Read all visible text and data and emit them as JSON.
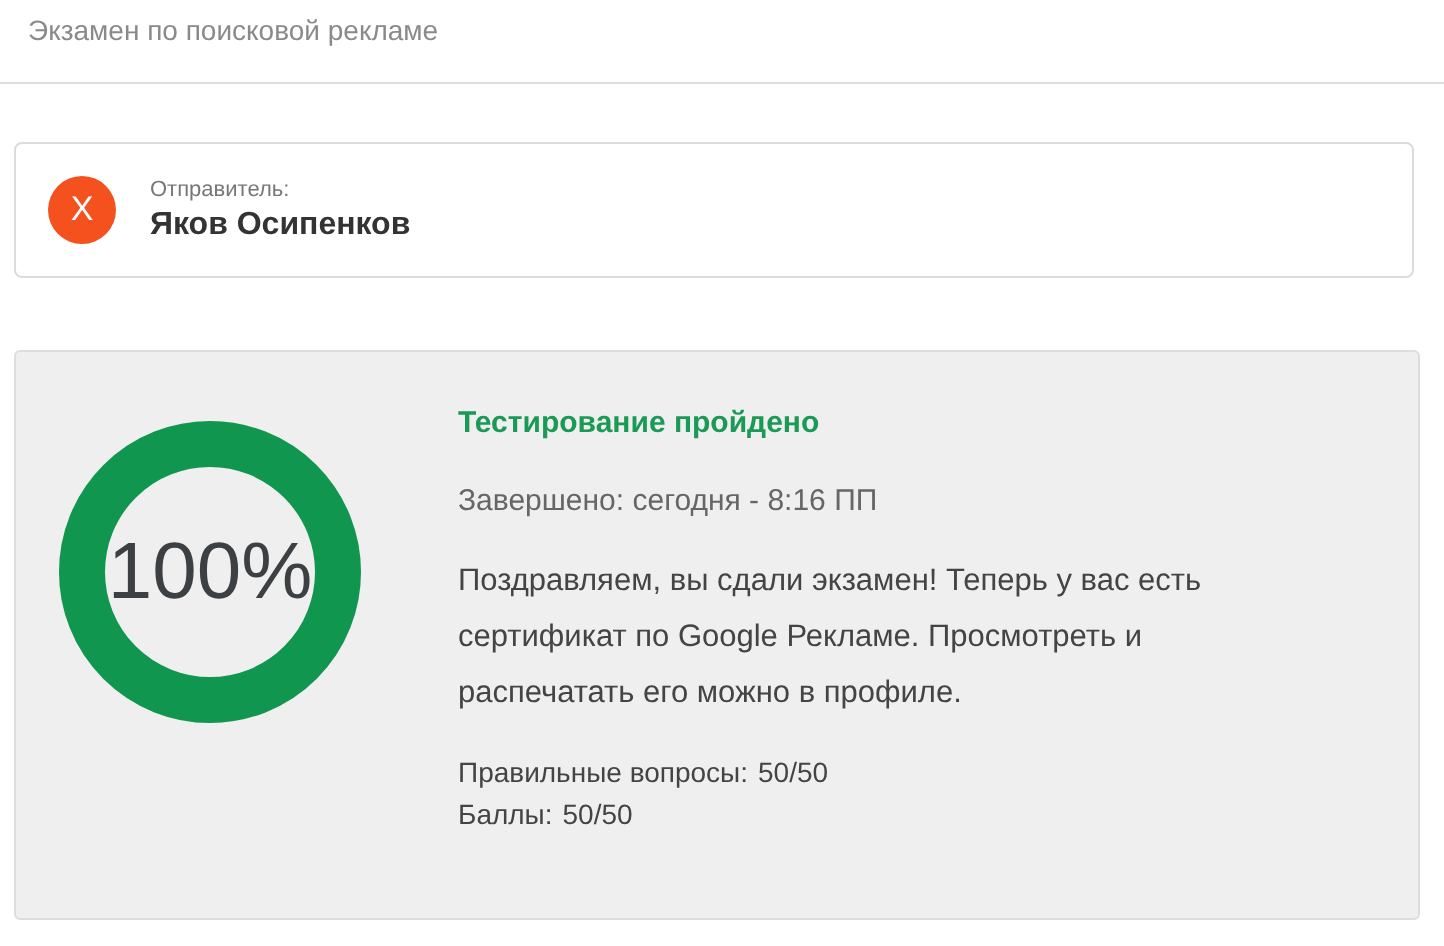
{
  "header": {
    "title": "Экзамен по поисковой рекламе"
  },
  "sender": {
    "avatar": "X",
    "label": "Отправитель:",
    "name": "Яков Осипенков"
  },
  "result": {
    "score": "100%",
    "level": 1,
    "status": "Тестирование пройдено",
    "completed": "Завершено: сегодня - 8:16 ПП",
    "message": "Поздравляем, вы сдали экзамен! Теперь у вас есть сертификат по Google Рекламе. Просмотреть и распечатать его можно в профиле.",
    "stats": [
      {
        "label": "Правильные вопросы:",
        "value": "50/50"
      },
      {
        "label": "Баллы:",
        "value": "50/50"
      }
    ]
  }
}
